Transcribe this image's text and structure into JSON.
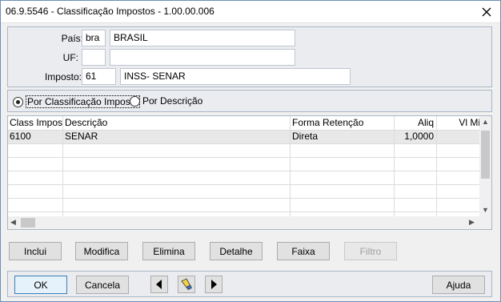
{
  "window": {
    "title": "06.9.5546 - Classificação Impostos - 1.00.00.006"
  },
  "header": {
    "pais_label": "País:",
    "pais_code": "bra",
    "pais_name": "BRASIL",
    "uf_label": "UF:",
    "uf_code": "",
    "uf_name": "",
    "imposto_label": "Imposto:",
    "imposto_code": "61",
    "imposto_name": "INSS- SENAR"
  },
  "order": {
    "option1": "Por Classificação Imposto",
    "option2": "Por Descrição",
    "selected": "option1"
  },
  "grid": {
    "columns": [
      "Class Imposto",
      "Descrição",
      "Forma Retenção",
      "Aliq",
      "Vl Mi"
    ],
    "rows": [
      [
        "6100",
        "SENAR",
        "Direta",
        "1,0000",
        ""
      ]
    ]
  },
  "actions": {
    "inclui": "Inclui",
    "modifica": "Modifica",
    "elimina": "Elimina",
    "detalhe": "Detalhe",
    "faixa": "Faixa",
    "filtro": "Filtro"
  },
  "footer": {
    "ok": "OK",
    "cancela": "Cancela",
    "ajuda": "Ajuda"
  }
}
